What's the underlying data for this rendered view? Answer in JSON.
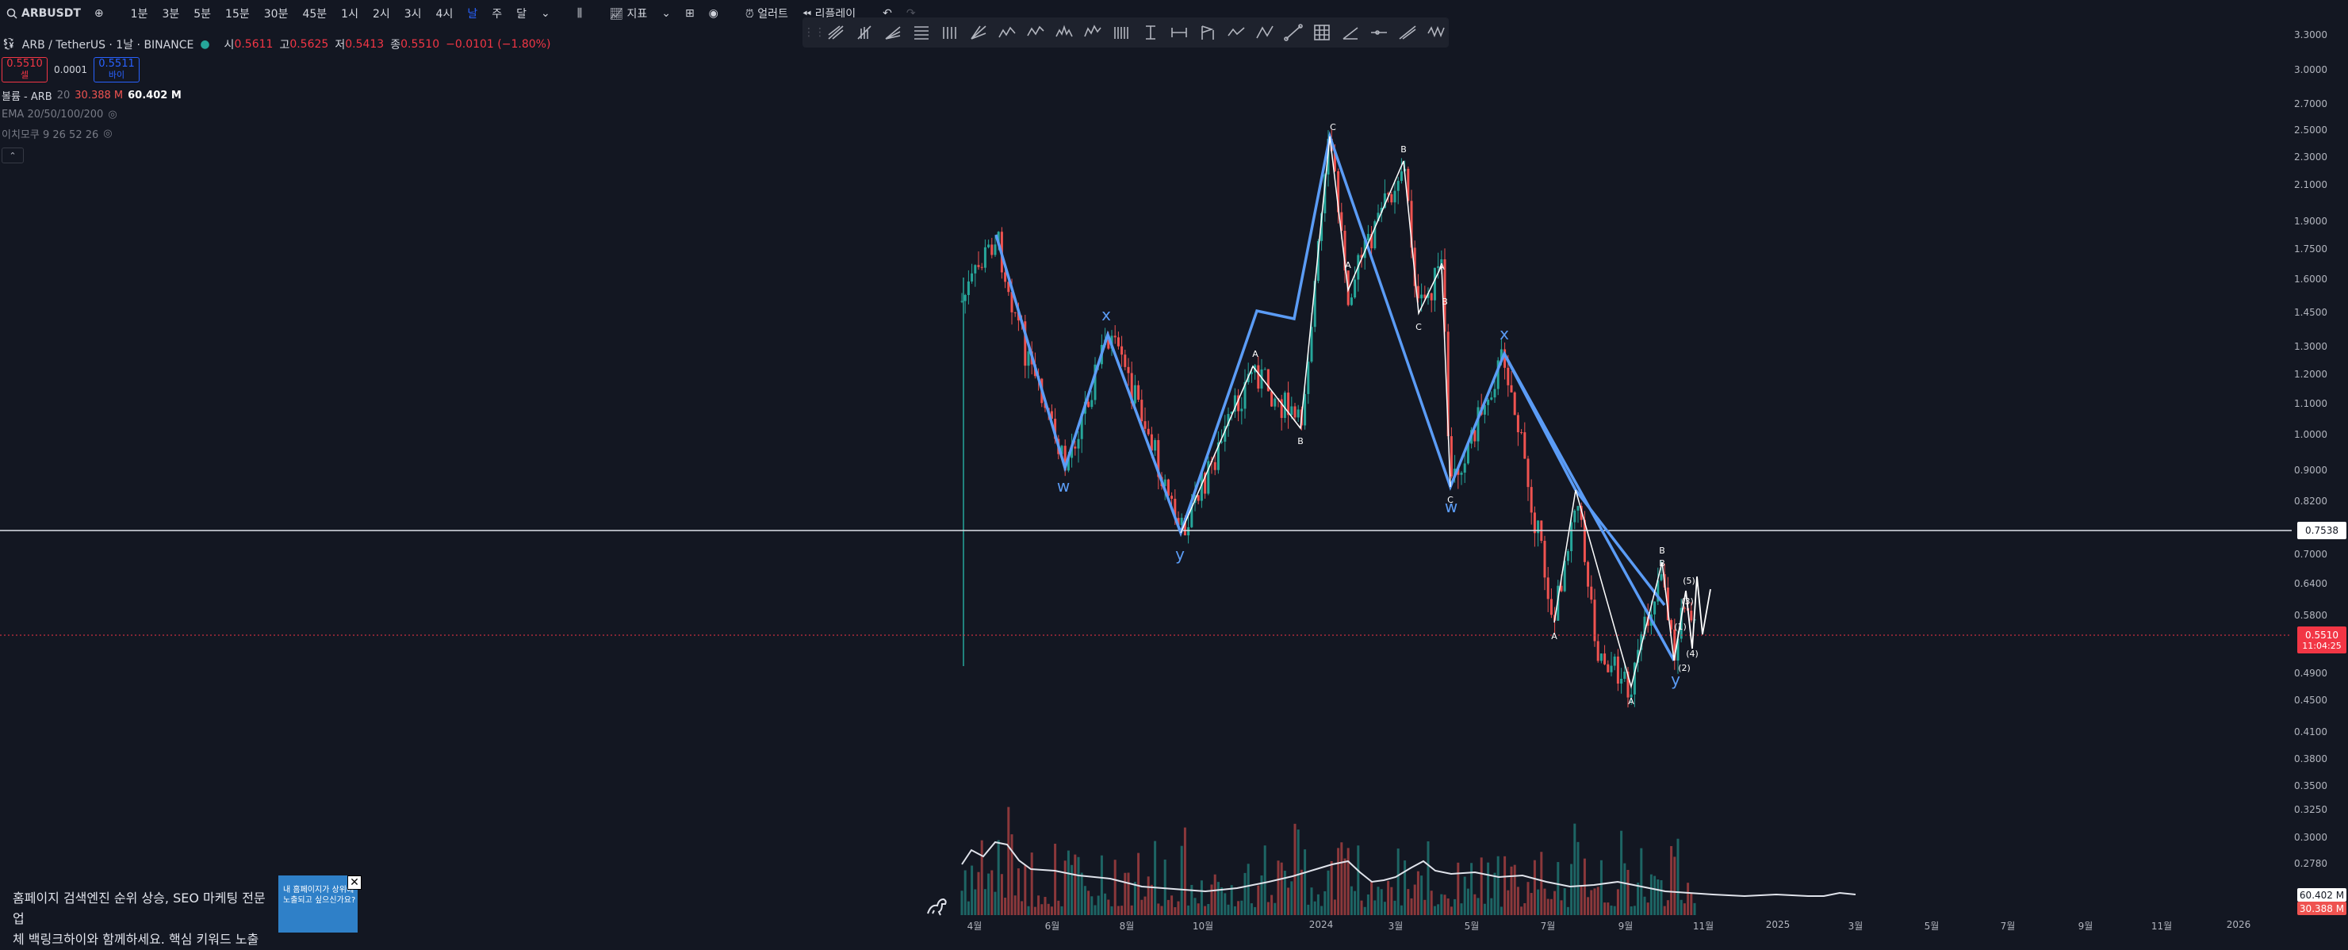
{
  "toolbar": {
    "symbol": "ARBUSDT",
    "intervals": [
      "1분",
      "3분",
      "5분",
      "15분",
      "30분",
      "45분",
      "1시",
      "2시",
      "3시",
      "4시",
      "날",
      "주",
      "달"
    ],
    "active_interval": "날",
    "indicators_label": "지표",
    "alert_label": "얼러트",
    "replay_label": "리플레이"
  },
  "legend": {
    "title": "ARB / TetherUS · 1날 · BINANCE",
    "open_label": "시",
    "open": "0.5611",
    "high_label": "고",
    "high": "0.5625",
    "low_label": "저",
    "low": "0.5413",
    "close_label": "종",
    "close": "0.5510",
    "change": "−0.0101 (−1.80%)",
    "sell_price": "0.5510",
    "sell_label": "셀",
    "spread": "0.0001",
    "buy_price": "0.5511",
    "buy_label": "바이",
    "volume_label": "볼륨 - ARB",
    "volume_len": "20",
    "volume_val1": "30.388 M",
    "volume_val2": "60.402 M",
    "ema_label": "EMA 20/50/100/200",
    "ichimoku_label": "이치모쿠 9 26 52 26"
  },
  "price_scale": {
    "ticks": [
      "3.3000",
      "3.0000",
      "2.7000",
      "2.5000",
      "2.3000",
      "2.1000",
      "1.9000",
      "1.7500",
      "1.6000",
      "1.4500",
      "1.3000",
      "1.2000",
      "1.1000",
      "1.0000",
      "0.9000",
      "0.8200",
      "0.7000",
      "0.6400",
      "0.5800",
      "0.4900",
      "0.4500",
      "0.4100",
      "0.3800",
      "0.3500",
      "0.3250",
      "0.3000",
      "0.2780"
    ],
    "hline_price": "0.7538",
    "current_price": "0.5510",
    "countdown": "11:04:25",
    "vol_tag1": "60.402 M",
    "vol_tag2": "30.388 M"
  },
  "time_scale": {
    "labels": [
      "4월",
      "6월",
      "8월",
      "10월",
      "2024",
      "3월",
      "5월",
      "7월",
      "9월",
      "11월",
      "2025",
      "3월",
      "5월",
      "7월",
      "9월",
      "11월",
      "2026"
    ]
  },
  "wave_labels": {
    "blue": [
      "w",
      "x",
      "y",
      "w",
      "x",
      "y"
    ],
    "white": [
      "A",
      "B",
      "C",
      "A",
      "B",
      "C",
      "A",
      "B",
      "C",
      "A",
      "B",
      "A",
      "B",
      "(1)",
      "(2)",
      "(3)",
      "(4)",
      "(5)"
    ]
  },
  "colors": {
    "bg": "#131722",
    "up": "#26a69a",
    "down": "#ef5350",
    "wave_blue": "#5b9cf6",
    "accent": "#2962ff"
  },
  "ad": {
    "line1": "홈페이지 검색엔진 순위 상승, SEO 마케팅 전문업",
    "line2": "체 백링크하이와 함께하세요. 핵심 키워드 노출",
    "image_text1": "내 홈페이지가 상위에",
    "image_text2": "노출되고 싶으신가요?"
  }
}
